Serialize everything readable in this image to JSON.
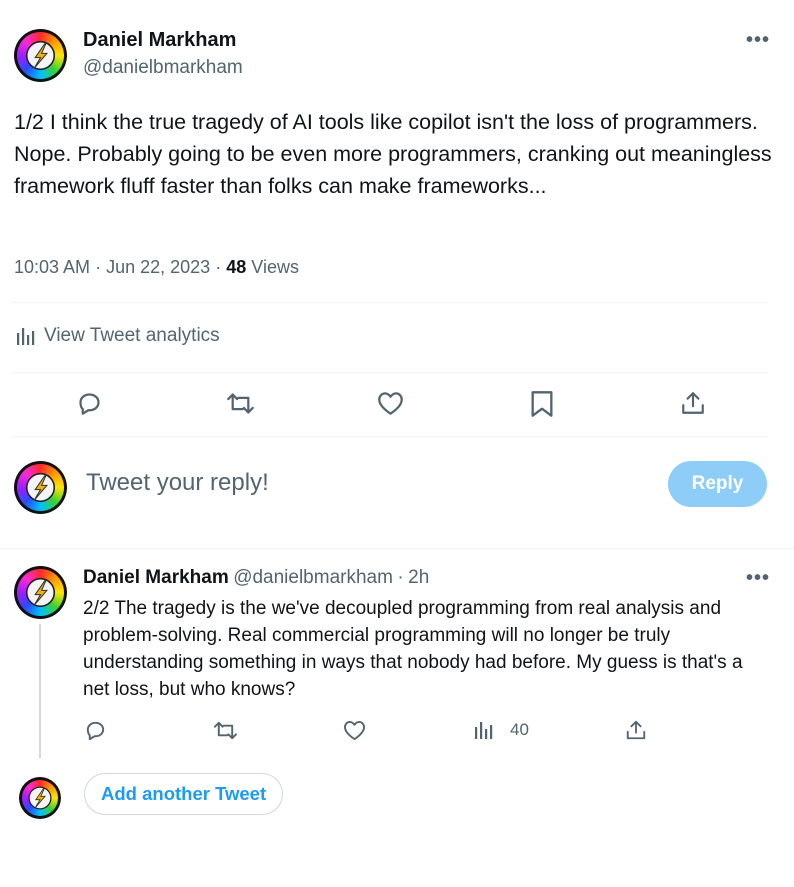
{
  "tweet": {
    "author_name": "Daniel Markham",
    "author_handle": "@danielbmarkham",
    "more_label": "•••",
    "text": "1/2 I think the true tragedy of AI tools like copilot isn't the loss of programmers. Nope. Probably going to be even more programmers, cranking out meaningless framework fluff faster than folks can make frameworks...",
    "time": "10:03 AM",
    "separator": "·",
    "date": "Jun 22, 2023",
    "views_count": "48",
    "views_label": "Views",
    "analytics_label": "View Tweet analytics",
    "actions": [
      "reply",
      "retweet",
      "like",
      "bookmark",
      "share"
    ]
  },
  "reply_composer": {
    "placeholder": "Tweet your reply!",
    "button_label": "Reply",
    "button_color": "#8ecdf8"
  },
  "reply_tweet": {
    "author_name": "Daniel Markham",
    "author_handle": "@danielbmarkham",
    "separator": "·",
    "time_ago": "2h",
    "more_label": "•••",
    "text": "2/2 The tragedy is the we've decoupled programming from real analysis and problem-solving. Real commercial programming will no longer be truly understanding something in ways that nobody had before. My guess is that's a net loss, but who knows?",
    "views_count": "40"
  },
  "add_tweet": {
    "button_label": "Add another Tweet"
  },
  "colors": {
    "accent": "#1d9bf0",
    "secondary_text": "#536471",
    "divider": "#eff3f4"
  }
}
